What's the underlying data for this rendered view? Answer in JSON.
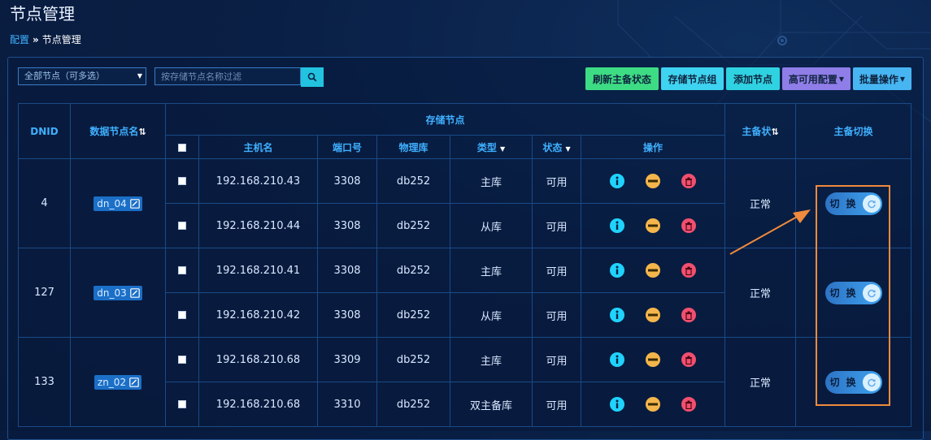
{
  "page": {
    "title": "节点管理",
    "breadcrumb": {
      "root": "配置",
      "separator": "»",
      "current": "节点管理"
    }
  },
  "filter": {
    "node_select_value": "全部节点（可多选）",
    "search_placeholder": "按存储节点名称过滤"
  },
  "toolbar": {
    "refresh_label": "刷新主备状态",
    "storage_group_label": "存储节点组",
    "add_node_label": "添加节点",
    "ha_config_label": "高可用配置",
    "batch_label": "批量操作",
    "colors": {
      "refresh": "#3ddc84",
      "storage_group": "#3ed3f0",
      "add_node": "#2fd2e0",
      "ha_config": "#8f7de8",
      "batch": "#47b5f2"
    }
  },
  "table": {
    "headers": {
      "dnid": "DNID",
      "datanode_name": "数据节点名",
      "storage_node": "存储节点",
      "hostname": "主机名",
      "port": "端口号",
      "physical_db": "物理库",
      "type": "类型",
      "status": "状态",
      "operation": "操作",
      "ms_status": "主备状",
      "ms_switch": "主备切换"
    },
    "groups": [
      {
        "dnid": "4",
        "name": "dn_04",
        "ms_status": "正常",
        "switch_label": "切换",
        "rows": [
          {
            "host": "192.168.210.43",
            "port": "3308",
            "db": "db252",
            "type": "主库",
            "status": "可用"
          },
          {
            "host": "192.168.210.44",
            "port": "3308",
            "db": "db252",
            "type": "从库",
            "status": "可用"
          }
        ]
      },
      {
        "dnid": "127",
        "name": "dn_03",
        "ms_status": "正常",
        "switch_label": "切换",
        "rows": [
          {
            "host": "192.168.210.41",
            "port": "3308",
            "db": "db252",
            "type": "主库",
            "status": "可用"
          },
          {
            "host": "192.168.210.42",
            "port": "3308",
            "db": "db252",
            "type": "从库",
            "status": "可用"
          }
        ]
      },
      {
        "dnid": "133",
        "name": "zn_02",
        "ms_status": "正常",
        "switch_label": "切换",
        "rows": [
          {
            "host": "192.168.210.68",
            "port": "3309",
            "db": "db252",
            "type": "主库",
            "status": "可用"
          },
          {
            "host": "192.168.210.68",
            "port": "3310",
            "db": "db252",
            "type": "双主备库",
            "status": "可用"
          }
        ]
      }
    ]
  },
  "annotation": {
    "highlight_color": "#f08a3c"
  }
}
